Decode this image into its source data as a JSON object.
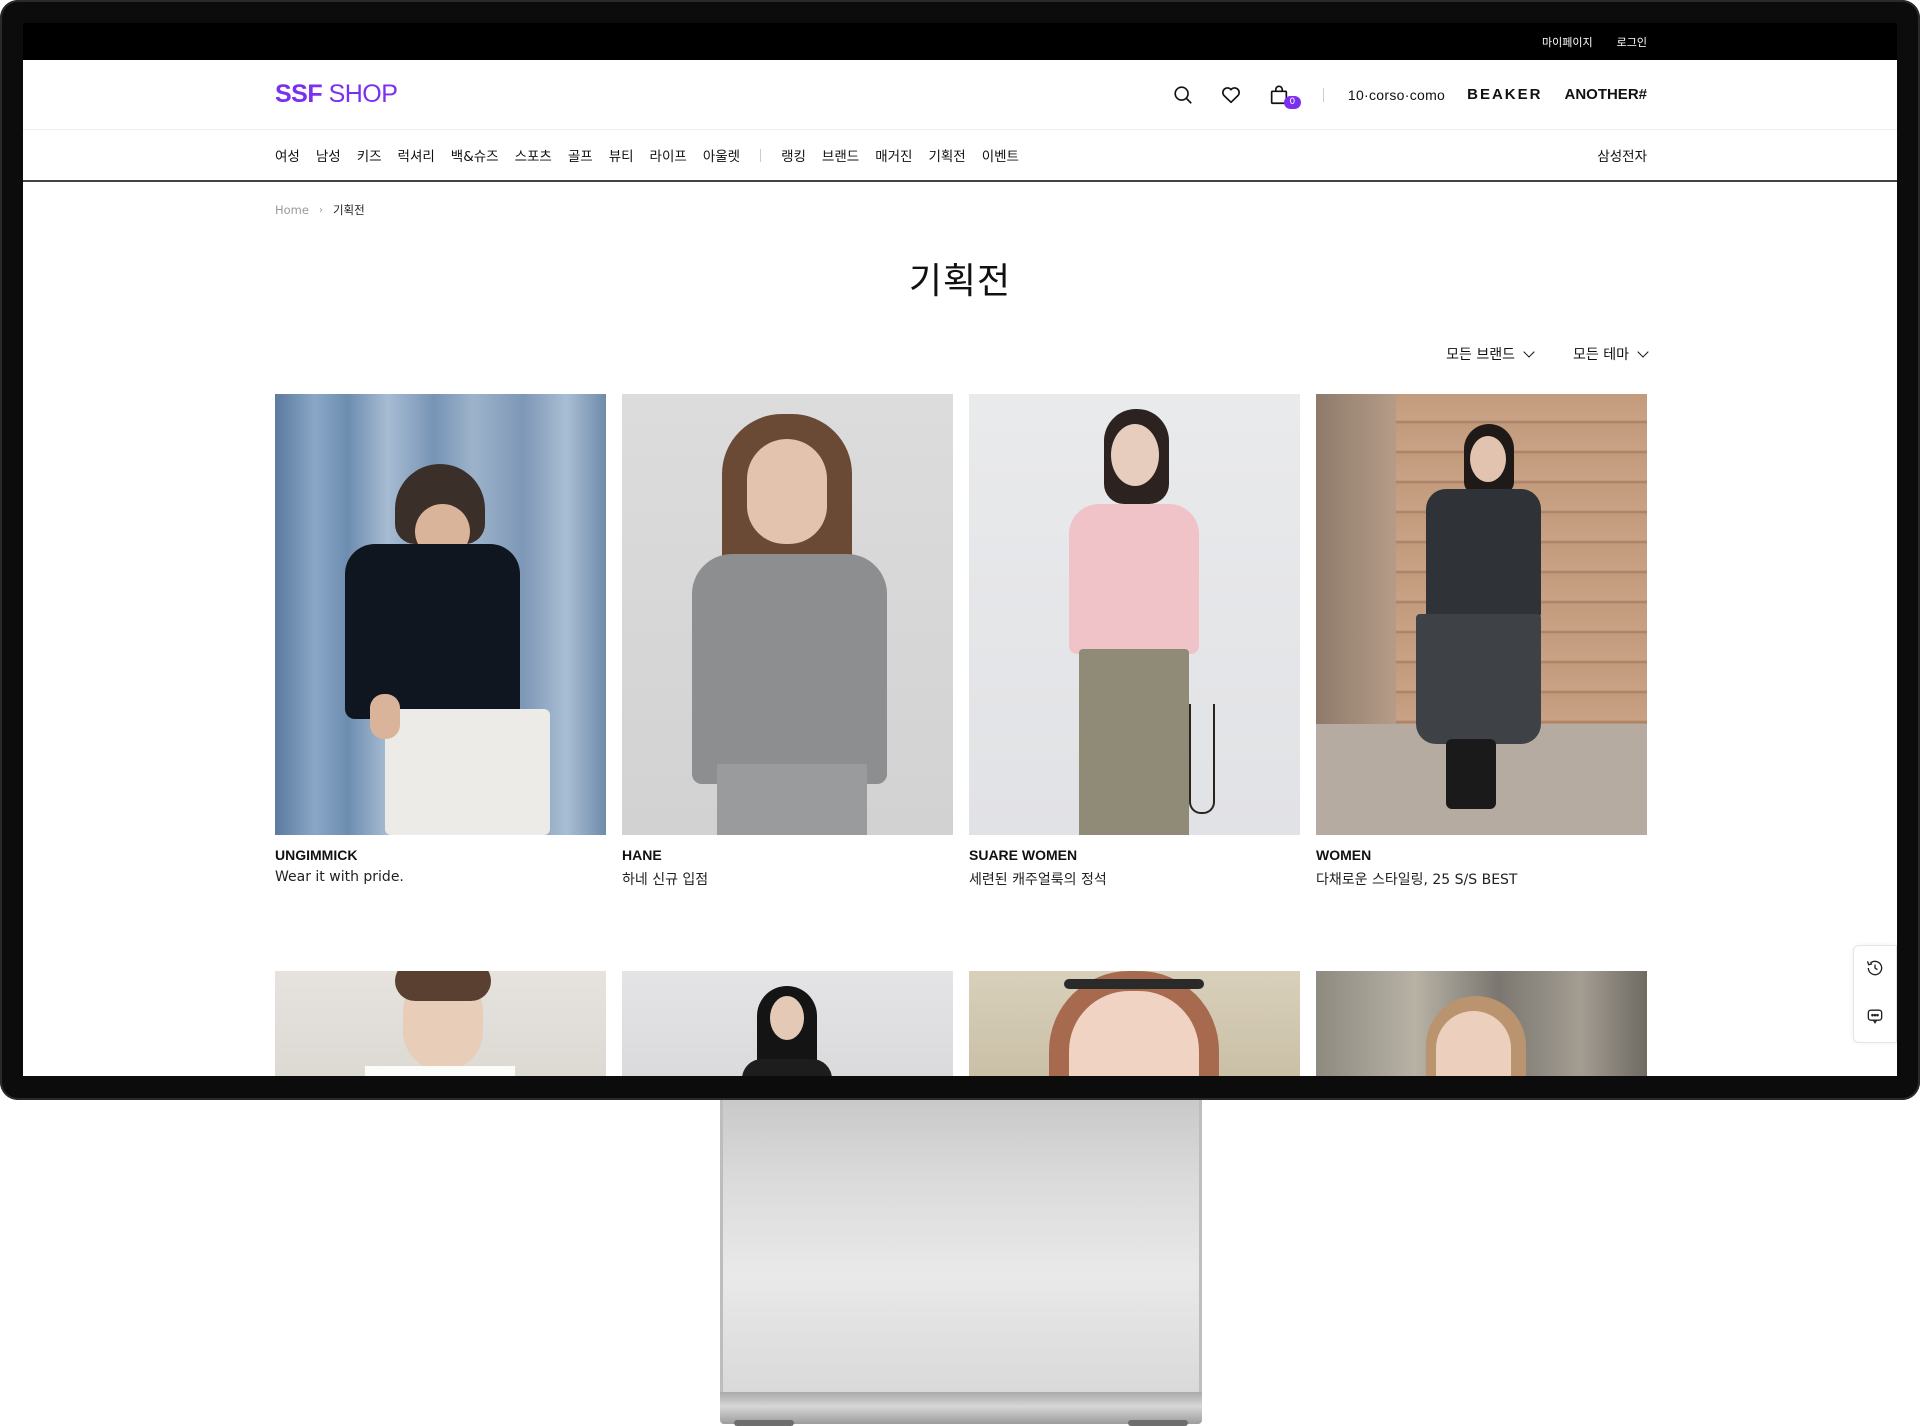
{
  "utility": {
    "mypage": "마이페이지",
    "login": "로그인"
  },
  "header": {
    "logo_bold": "SSF",
    "logo_light": "SHOP",
    "cart_count": "0",
    "brands": [
      "10·corso·como",
      "BEAKER",
      "ANOTHER#"
    ]
  },
  "nav": {
    "categories": [
      "여성",
      "남성",
      "키즈",
      "럭셔리",
      "백&슈즈",
      "스포츠",
      "골프",
      "뷰티",
      "라이프",
      "아울렛"
    ],
    "sections": [
      "랭킹",
      "브랜드",
      "매거진",
      "기획전",
      "이벤트"
    ],
    "right": "삼성전자"
  },
  "breadcrumb": {
    "home": "Home",
    "current": "기획전"
  },
  "page_title": "기획전",
  "filters": {
    "brand": "모든 브랜드",
    "theme": "모든 테마"
  },
  "cards": [
    {
      "brand": "UNGIMMICK",
      "tagline": "Wear it with pride."
    },
    {
      "brand": "HANE",
      "tagline": "하네 신규 입점"
    },
    {
      "brand": "SUARE WOMEN",
      "tagline": "세련된 캐주얼룩의 정석"
    },
    {
      "brand": "WOMEN",
      "tagline": "다채로운 스타일링, 25 S/S BEST"
    }
  ],
  "colors": {
    "brand_purple": "#7b2ff0",
    "bezel": "#0c0c0c"
  },
  "icons": [
    "search-icon",
    "heart-icon",
    "shopping-bag-icon",
    "history-icon",
    "chat-icon"
  ]
}
